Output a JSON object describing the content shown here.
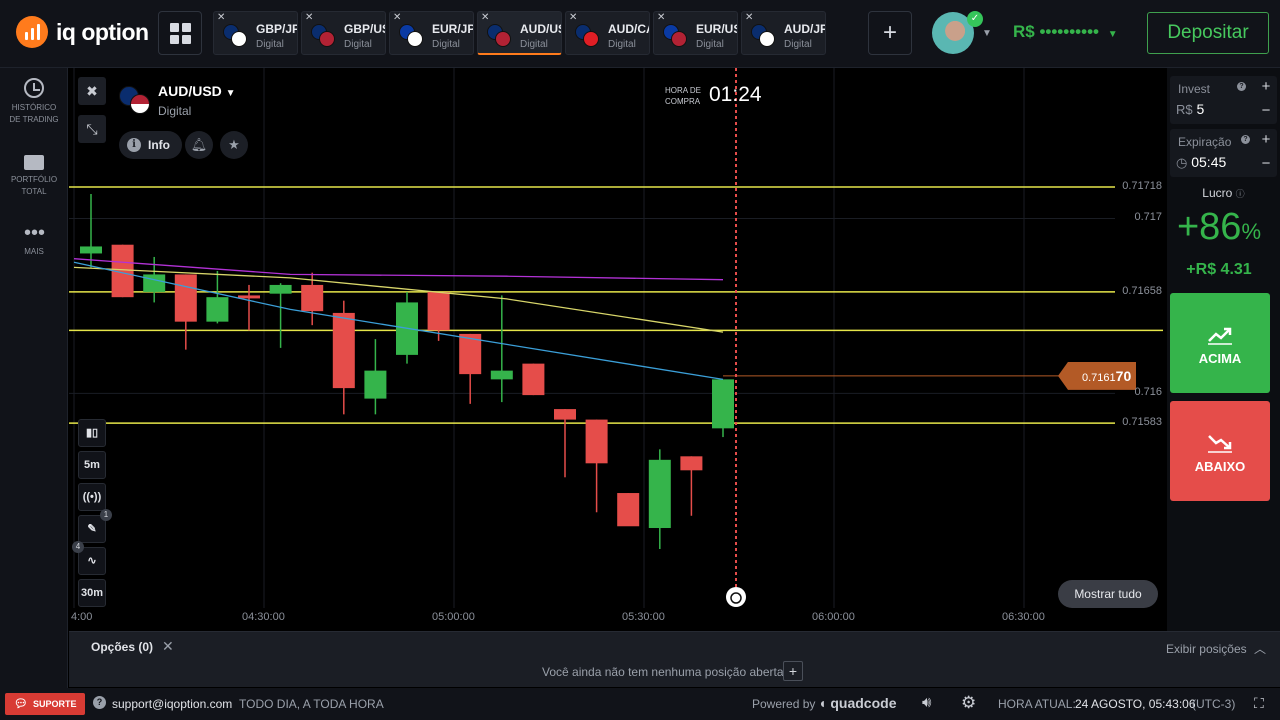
{
  "brand": {
    "name": "iq option"
  },
  "tabs": [
    {
      "pair": "GBP/JPY",
      "type": "Digital",
      "flags": [
        "#0a2d6e",
        "#ffffff"
      ],
      "active": false
    },
    {
      "pair": "GBP/USD",
      "type": "Digital",
      "flags": [
        "#0a2d6e",
        "#b22234"
      ],
      "active": false
    },
    {
      "pair": "EUR/JPY",
      "type": "Digital",
      "flags": [
        "#0a3aa3",
        "#ffffff"
      ],
      "active": false
    },
    {
      "pair": "AUD/USD",
      "type": "Digital",
      "flags": [
        "#0a2d6e",
        "#b22234"
      ],
      "active": true
    },
    {
      "pair": "AUD/CAD",
      "type": "Digital",
      "flags": [
        "#0a2d6e",
        "#e01e25"
      ],
      "active": false
    },
    {
      "pair": "EUR/USD",
      "type": "Digital",
      "flags": [
        "#0a3aa3",
        "#b22234"
      ],
      "active": false
    },
    {
      "pair": "AUD/JPY",
      "type": "Digital",
      "flags": [
        "#0a2d6e",
        "#ffffff"
      ],
      "active": false
    }
  ],
  "header": {
    "plus_label": "+",
    "balance": "R$ ••••••••••",
    "deposit_label": "Depositar"
  },
  "sidebar": {
    "items": [
      {
        "label_1": "HISTÓRICO",
        "label_2": "DE TRADING",
        "icon": "clock-icon"
      },
      {
        "label_1": "PORTFÓLIO",
        "label_2": "TOTAL",
        "icon": "briefcase-icon"
      },
      {
        "label_1": "MAIS",
        "label_2": "",
        "icon": "more-icon"
      }
    ]
  },
  "asset": {
    "name": "AUD/USD",
    "type": "Digital",
    "info_label": "Info"
  },
  "purchase": {
    "label_1": "HORA DE",
    "label_2": "COMPRA",
    "time": "01:24"
  },
  "tools": {
    "timeframe": "5m",
    "period": "30m",
    "drawings_count": "1",
    "indicators_count": "4"
  },
  "show_all_label": "Mostrar tudo",
  "current_price": {
    "prefix": "0.7161",
    "suffix": "70"
  },
  "chart_data": {
    "type": "candlestick",
    "x_ticks": [
      "4:00",
      "04:30:00",
      "05:00:00",
      "05:30:00",
      "06:00:00",
      "06:30:00"
    ],
    "y_ticks": [
      0.717,
      0.716
    ],
    "horizontal_levels": [
      0.71718,
      0.71658,
      0.71583
    ],
    "horizontal_levels_unlabeled": [
      0.71636
    ],
    "current_price": 0.7161,
    "candles": [
      {
        "o": 0.7168,
        "h": 0.71714,
        "l": 0.71672,
        "c": 0.71684
      },
      {
        "o": 0.71685,
        "h": 0.71685,
        "l": 0.71655,
        "c": 0.71655
      },
      {
        "o": 0.71658,
        "h": 0.71678,
        "l": 0.71652,
        "c": 0.71668
      },
      {
        "o": 0.71668,
        "h": 0.71668,
        "l": 0.71625,
        "c": 0.71641
      },
      {
        "o": 0.71641,
        "h": 0.7167,
        "l": 0.7164,
        "c": 0.71655
      },
      {
        "o": 0.71656,
        "h": 0.71662,
        "l": 0.71636,
        "c": 0.71655
      },
      {
        "o": 0.71657,
        "h": 0.71663,
        "l": 0.71626,
        "c": 0.71662
      },
      {
        "o": 0.71662,
        "h": 0.71669,
        "l": 0.71639,
        "c": 0.71647
      },
      {
        "o": 0.71646,
        "h": 0.71653,
        "l": 0.71588,
        "c": 0.71603
      },
      {
        "o": 0.71597,
        "h": 0.71631,
        "l": 0.71588,
        "c": 0.71613
      },
      {
        "o": 0.71622,
        "h": 0.71658,
        "l": 0.71617,
        "c": 0.71652
      },
      {
        "o": 0.71658,
        "h": 0.71658,
        "l": 0.7163,
        "c": 0.71636
      },
      {
        "o": 0.71634,
        "h": 0.71634,
        "l": 0.71594,
        "c": 0.71611
      },
      {
        "o": 0.71608,
        "h": 0.71656,
        "l": 0.71595,
        "c": 0.71613
      },
      {
        "o": 0.71617,
        "h": 0.71617,
        "l": 0.71599,
        "c": 0.71599
      },
      {
        "o": 0.71591,
        "h": 0.71591,
        "l": 0.71552,
        "c": 0.71585
      },
      {
        "o": 0.71585,
        "h": 0.71585,
        "l": 0.71532,
        "c": 0.7156
      },
      {
        "o": 0.71543,
        "h": 0.71543,
        "l": 0.71528,
        "c": 0.71524
      },
      {
        "o": 0.71523,
        "h": 0.71568,
        "l": 0.71511,
        "c": 0.71562
      },
      {
        "o": 0.71564,
        "h": 0.71564,
        "l": 0.7153,
        "c": 0.71556
      },
      {
        "o": 0.7158,
        "h": 0.71604,
        "l": 0.71575,
        "c": 0.71608
      }
    ],
    "moving_averages": [
      {
        "name": "",
        "color": "#b232d6",
        "values": [
          0.71677,
          0.71668,
          0.71667,
          0.71665
        ]
      },
      {
        "name": "",
        "color": "#d8d66a",
        "values": [
          0.71672,
          0.71666,
          0.71654,
          0.71635
        ]
      },
      {
        "name": "",
        "color": "#3b9fd8",
        "values": [
          0.71675,
          0.71648,
          0.71628,
          0.71608
        ]
      }
    ],
    "colors": {
      "up": "#35b44b",
      "down": "#e54d4a",
      "level": "#e5e54a",
      "grid": "#1a1d24"
    }
  },
  "trade": {
    "invest_label": "Invest",
    "invest_currency": "R$",
    "invest_value": "5",
    "expiry_label": "Expiração",
    "expiry_value": "05:45",
    "profit_label": "Lucro",
    "profit_pct": "+86",
    "profit_pct_unit": "%",
    "profit_value": "+R$ 4.31",
    "up_label": "ACIMA",
    "down_label": "ABAIXO"
  },
  "options_bar": {
    "title": "Opções (0)",
    "empty_message": "Você ainda não tem nenhuma posição aberta",
    "show_positions": "Exibir posições"
  },
  "footer": {
    "support_label": "SUPORTE",
    "email": "support@iqoption.com",
    "hours": "TODO DIA, A TODA HORA",
    "powered_by": "Powered by",
    "powered_brand": "quadcode",
    "current_time_label": "HORA ATUAL:",
    "current_time": "24 AGOSTO, 05:43:06",
    "timezone": "(UTC-3)"
  }
}
